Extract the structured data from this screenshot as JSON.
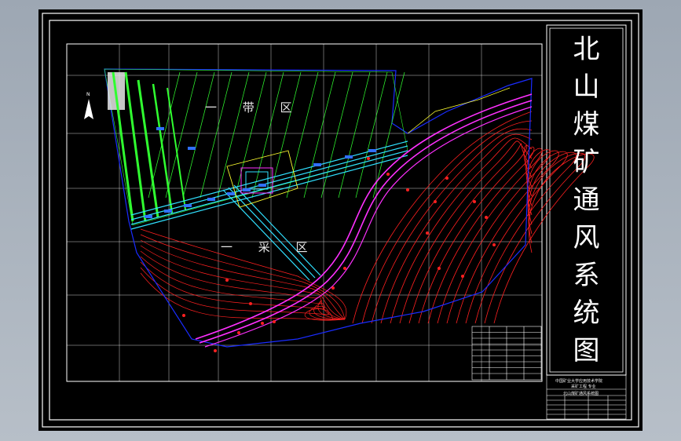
{
  "drawing": {
    "title_chars": [
      "北",
      "山",
      "煤",
      "矿",
      "通",
      "风",
      "系",
      "统",
      "图"
    ],
    "zone_upper": "一 带 区",
    "zone_lower": "一 采 区",
    "north_mark": "N"
  },
  "title_block": {
    "school_line": "中国矿业大学应用技术学院",
    "major_line": "采矿工程 专业",
    "drawing_line": "北山煤矿通风系统图"
  },
  "colors": {
    "sheet": "#000000",
    "frame": "#ffffff",
    "grid": "#ffffff",
    "contour": "#ff2020",
    "boundary": "#1a2cff",
    "panel_green": "#30ff30",
    "airway_cyan": "#30e0ff",
    "road_magenta": "#ff30ff",
    "yellow_outline": "#ffff30"
  }
}
